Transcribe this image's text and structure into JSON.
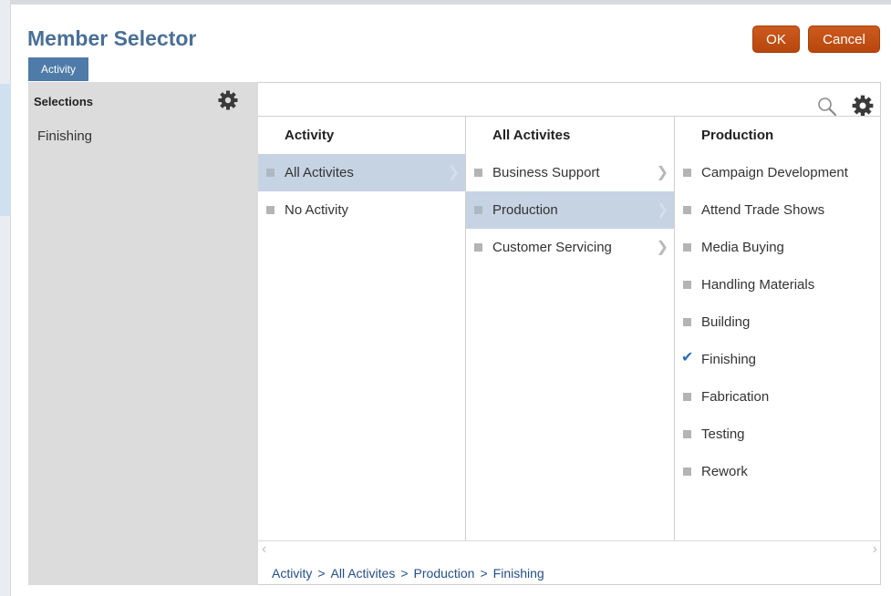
{
  "dialog": {
    "title": "Member Selector",
    "ok_label": "OK",
    "cancel_label": "Cancel"
  },
  "dimension_tab": "Activity",
  "selections": {
    "title": "Selections",
    "items": [
      "Finishing"
    ]
  },
  "columns": [
    {
      "header": "Activity",
      "rows": [
        {
          "label": "All Activites",
          "selected": true,
          "has_children": true
        },
        {
          "label": "No Activity",
          "selected": false,
          "has_children": false
        }
      ]
    },
    {
      "header": "All Activites",
      "rows": [
        {
          "label": "Business Support",
          "selected": false,
          "has_children": true
        },
        {
          "label": "Production",
          "selected": true,
          "has_children": true
        },
        {
          "label": "Customer Servicing",
          "selected": false,
          "has_children": true
        }
      ]
    },
    {
      "header": "Production",
      "rows": [
        {
          "label": "Campaign Development",
          "checked": false
        },
        {
          "label": "Attend Trade Shows",
          "checked": false
        },
        {
          "label": "Media Buying",
          "checked": false
        },
        {
          "label": "Handling Materials",
          "checked": false
        },
        {
          "label": "Building",
          "checked": false
        },
        {
          "label": "Finishing",
          "checked": true
        },
        {
          "label": "Fabrication",
          "checked": false
        },
        {
          "label": "Testing",
          "checked": false
        },
        {
          "label": "Rework",
          "checked": false
        }
      ]
    }
  ],
  "breadcrumb": [
    "Activity",
    "All Activites",
    "Production",
    "Finishing"
  ],
  "breadcrumb_separator": ">",
  "colors": {
    "title": "#4a6f95",
    "button": "#c4511a",
    "tab": "#4e7ba8",
    "row_selected": "#c6d3e3",
    "check": "#2a6fb8",
    "breadcrumb": "#244f86"
  }
}
